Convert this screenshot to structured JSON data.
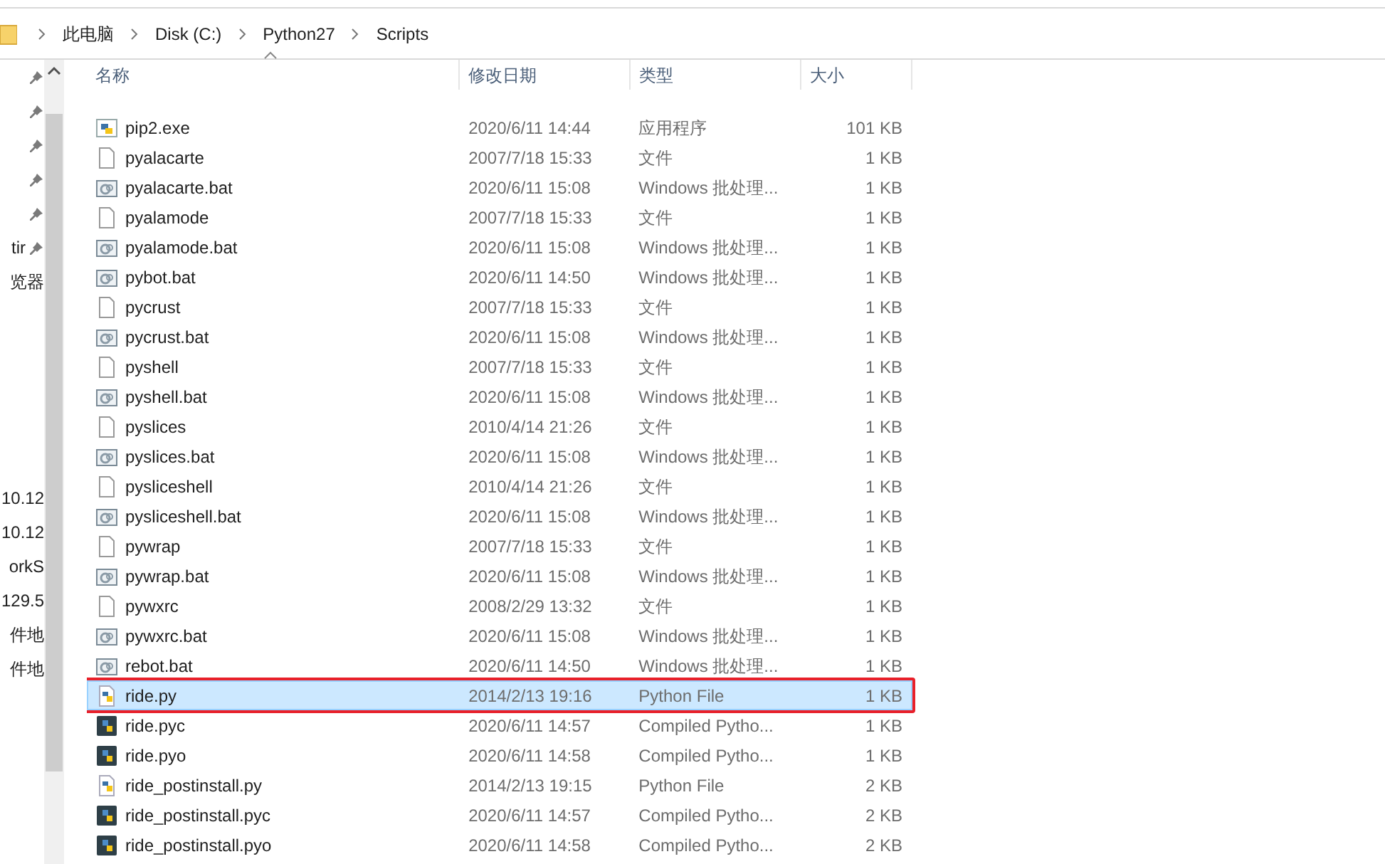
{
  "breadcrumb": [
    "此电脑",
    "Disk (C:)",
    "Python27",
    "Scripts"
  ],
  "nav_pane": [
    {
      "pinned": true
    },
    {
      "pinned": true
    },
    {
      "pinned": true
    },
    {
      "pinned": true
    },
    {
      "pinned": true
    },
    {
      "text": "tir",
      "pinned": true
    },
    {
      "text": "览器",
      "pinned": false
    },
    {
      "text": "10.12",
      "pinned": false
    },
    {
      "text": "10.12",
      "pinned": false
    },
    {
      "text": "orkS",
      "pinned": false
    },
    {
      "text": "129.5",
      "pinned": false
    },
    {
      "text": "件地",
      "pinned": false
    },
    {
      "text": "件地",
      "pinned": false
    }
  ],
  "table": {
    "columns": [
      "名称",
      "修改日期",
      "类型",
      "大小"
    ],
    "rows": [
      {
        "kind": "exe",
        "name": "pip2.exe",
        "date": "2020/6/11 14:44",
        "type": "应用程序",
        "size": "101 KB",
        "selected": false,
        "annotated": false
      },
      {
        "kind": "file",
        "name": "pyalacarte",
        "date": "2007/7/18 15:33",
        "type": "文件",
        "size": "1 KB",
        "selected": false,
        "annotated": false
      },
      {
        "kind": "bat",
        "name": "pyalacarte.bat",
        "date": "2020/6/11 15:08",
        "type": "Windows 批处理...",
        "size": "1 KB",
        "selected": false,
        "annotated": false
      },
      {
        "kind": "file",
        "name": "pyalamode",
        "date": "2007/7/18 15:33",
        "type": "文件",
        "size": "1 KB",
        "selected": false,
        "annotated": false
      },
      {
        "kind": "bat",
        "name": "pyalamode.bat",
        "date": "2020/6/11 15:08",
        "type": "Windows 批处理...",
        "size": "1 KB",
        "selected": false,
        "annotated": false
      },
      {
        "kind": "bat",
        "name": "pybot.bat",
        "date": "2020/6/11 14:50",
        "type": "Windows 批处理...",
        "size": "1 KB",
        "selected": false,
        "annotated": false
      },
      {
        "kind": "file",
        "name": "pycrust",
        "date": "2007/7/18 15:33",
        "type": "文件",
        "size": "1 KB",
        "selected": false,
        "annotated": false
      },
      {
        "kind": "bat",
        "name": "pycrust.bat",
        "date": "2020/6/11 15:08",
        "type": "Windows 批处理...",
        "size": "1 KB",
        "selected": false,
        "annotated": false
      },
      {
        "kind": "file",
        "name": "pyshell",
        "date": "2007/7/18 15:33",
        "type": "文件",
        "size": "1 KB",
        "selected": false,
        "annotated": false
      },
      {
        "kind": "bat",
        "name": "pyshell.bat",
        "date": "2020/6/11 15:08",
        "type": "Windows 批处理...",
        "size": "1 KB",
        "selected": false,
        "annotated": false
      },
      {
        "kind": "file",
        "name": "pyslices",
        "date": "2010/4/14 21:26",
        "type": "文件",
        "size": "1 KB",
        "selected": false,
        "annotated": false
      },
      {
        "kind": "bat",
        "name": "pyslices.bat",
        "date": "2020/6/11 15:08",
        "type": "Windows 批处理...",
        "size": "1 KB",
        "selected": false,
        "annotated": false
      },
      {
        "kind": "file",
        "name": "pysliceshell",
        "date": "2010/4/14 21:26",
        "type": "文件",
        "size": "1 KB",
        "selected": false,
        "annotated": false
      },
      {
        "kind": "bat",
        "name": "pysliceshell.bat",
        "date": "2020/6/11 15:08",
        "type": "Windows 批处理...",
        "size": "1 KB",
        "selected": false,
        "annotated": false
      },
      {
        "kind": "file",
        "name": "pywrap",
        "date": "2007/7/18 15:33",
        "type": "文件",
        "size": "1 KB",
        "selected": false,
        "annotated": false
      },
      {
        "kind": "bat",
        "name": "pywrap.bat",
        "date": "2020/6/11 15:08",
        "type": "Windows 批处理...",
        "size": "1 KB",
        "selected": false,
        "annotated": false
      },
      {
        "kind": "file",
        "name": "pywxrc",
        "date": "2008/2/29 13:32",
        "type": "文件",
        "size": "1 KB",
        "selected": false,
        "annotated": false
      },
      {
        "kind": "bat",
        "name": "pywxrc.bat",
        "date": "2020/6/11 15:08",
        "type": "Windows 批处理...",
        "size": "1 KB",
        "selected": false,
        "annotated": false
      },
      {
        "kind": "bat",
        "name": "rebot.bat",
        "date": "2020/6/11 14:50",
        "type": "Windows 批处理...",
        "size": "1 KB",
        "selected": false,
        "annotated": false
      },
      {
        "kind": "py",
        "name": "ride.py",
        "date": "2014/2/13 19:16",
        "type": "Python File",
        "size": "1 KB",
        "selected": true,
        "annotated": true
      },
      {
        "kind": "pyc",
        "name": "ride.pyc",
        "date": "2020/6/11 14:57",
        "type": "Compiled Pytho...",
        "size": "1 KB",
        "selected": false,
        "annotated": false
      },
      {
        "kind": "pyc",
        "name": "ride.pyo",
        "date": "2020/6/11 14:58",
        "type": "Compiled Pytho...",
        "size": "1 KB",
        "selected": false,
        "annotated": false
      },
      {
        "kind": "py",
        "name": "ride_postinstall.py",
        "date": "2014/2/13 19:15",
        "type": "Python File",
        "size": "2 KB",
        "selected": false,
        "annotated": false
      },
      {
        "kind": "pyc",
        "name": "ride_postinstall.pyc",
        "date": "2020/6/11 14:57",
        "type": "Compiled Pytho...",
        "size": "2 KB",
        "selected": false,
        "annotated": false
      },
      {
        "kind": "pyc",
        "name": "ride_postinstall.pyo",
        "date": "2020/6/11 14:58",
        "type": "Compiled Pytho...",
        "size": "2 KB",
        "selected": false,
        "annotated": false
      }
    ]
  }
}
